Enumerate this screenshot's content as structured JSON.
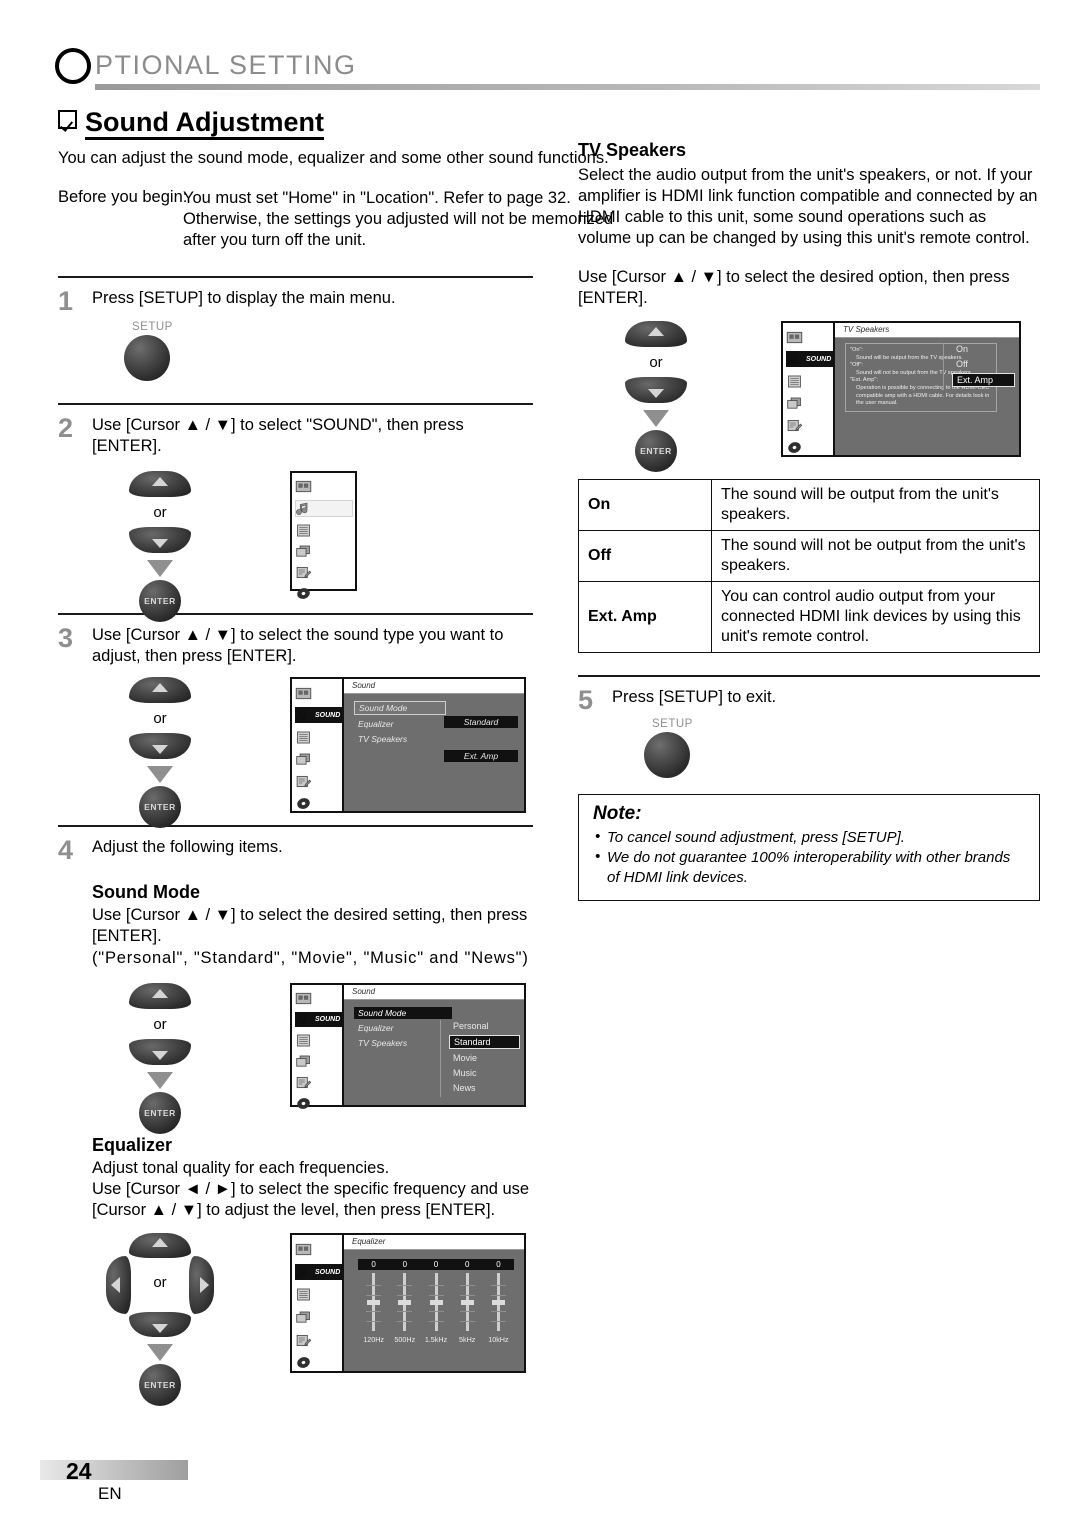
{
  "header": {
    "chapter_initial": "O",
    "chapter_title": "PTIONAL SETTING"
  },
  "section": {
    "title": "Sound Adjustment",
    "intro": "You can adjust the sound mode, equalizer and some other sound functions.",
    "before_label": "Before you begin:",
    "before_body": "You must set \"Home\" in \"Location\". Refer to page 32. Otherwise, the settings you adjusted will not be memorized after you turn off the unit."
  },
  "steps": {
    "s1": {
      "num": "1",
      "text": "Press [SETUP] to display the main menu.",
      "button_label": "SETUP"
    },
    "s2": {
      "num": "2",
      "text": "Use [Cursor ▲ / ▼] to select \"SOUND\", then press [ENTER].",
      "or_label": "or",
      "enter_label": "ENTER"
    },
    "s3": {
      "num": "3",
      "text": "Use [Cursor ▲ / ▼] to select the sound type you want to adjust, then press [ENTER].",
      "or_label": "or",
      "enter_label": "ENTER"
    },
    "s4": {
      "num": "4",
      "text": "Adjust the following items."
    },
    "s5": {
      "num": "5",
      "text": "Press [SETUP] to exit.",
      "button_label": "SETUP"
    }
  },
  "sound_mode": {
    "heading": "Sound Mode",
    "body": "Use [Cursor ▲ / ▼] to select the desired setting, then press [ENTER].",
    "options_line": "(\"Personal\", \"Standard\", \"Movie\", \"Music\" and \"News\")"
  },
  "equalizer": {
    "heading": "Equalizer",
    "line1": "Adjust tonal quality for each frequencies.",
    "line2": "Use [Cursor ◄ / ►] to select the specific frequency and use [Cursor ▲ / ▼] to adjust the level, then press [ENTER]."
  },
  "tv_speakers": {
    "heading": "TV Speakers",
    "body": "Select the audio output from the unit's speakers, or not. If your amplifier is HDMI link function compatible and connected by an HDMI cable to this unit, some sound operations such as volume up can be changed by using this unit's remote control.",
    "instruction": "Use [Cursor ▲ / ▼] to select the desired option, then press [ENTER].",
    "or_label": "or",
    "enter_label": "ENTER",
    "table": [
      {
        "key": "On",
        "desc": "The sound will be output from the unit's speakers."
      },
      {
        "key": "Off",
        "desc": "The sound will not be output from the unit's speakers."
      },
      {
        "key": "Ext. Amp",
        "desc": "You can control audio output from your connected HDMI link devices by using this unit's remote control."
      }
    ]
  },
  "note": {
    "title": "Note:",
    "items": [
      "To cancel sound adjustment, press [SETUP].",
      "We do not guarantee 100% interoperability with other brands of HDMI link devices."
    ]
  },
  "osd": {
    "icon_sound_label": "SOUND",
    "menu_main": {
      "title": ""
    },
    "menu_sound": {
      "title": "Sound",
      "rows": [
        "Sound Mode",
        "Equalizer",
        "TV Speakers"
      ],
      "values": [
        "Standard",
        "Ext. Amp"
      ]
    },
    "menu_sound_mode": {
      "title": "Sound",
      "rows": [
        "Sound Mode",
        "Equalizer",
        "TV Speakers"
      ],
      "options": [
        "Personal",
        "Standard",
        "Movie",
        "Music",
        "News"
      ],
      "selected_option": "Standard"
    },
    "menu_tv_speakers": {
      "title": "TV Speakers",
      "help": [
        "\"On\":",
        "Sound will be output from the TV speakers.",
        "\"Off\":",
        "Sound will not be output from the TV speakers.",
        "\"Ext. Amp\":",
        "Operation is possible by connecting to the HDMI-CEC compatible amp with a HDMI cable. For details look in the user manual."
      ],
      "options": [
        "On",
        "Off",
        "Ext. Amp"
      ],
      "selected_option": "Ext. Amp"
    },
    "menu_equalizer": {
      "title": "Equalizer",
      "bands": [
        "120Hz",
        "500Hz",
        "1.5kHz",
        "5kHz",
        "10kHz"
      ],
      "values": [
        "0",
        "0",
        "0",
        "0",
        "0"
      ]
    }
  },
  "footer": {
    "page_number": "24",
    "language": "EN"
  }
}
